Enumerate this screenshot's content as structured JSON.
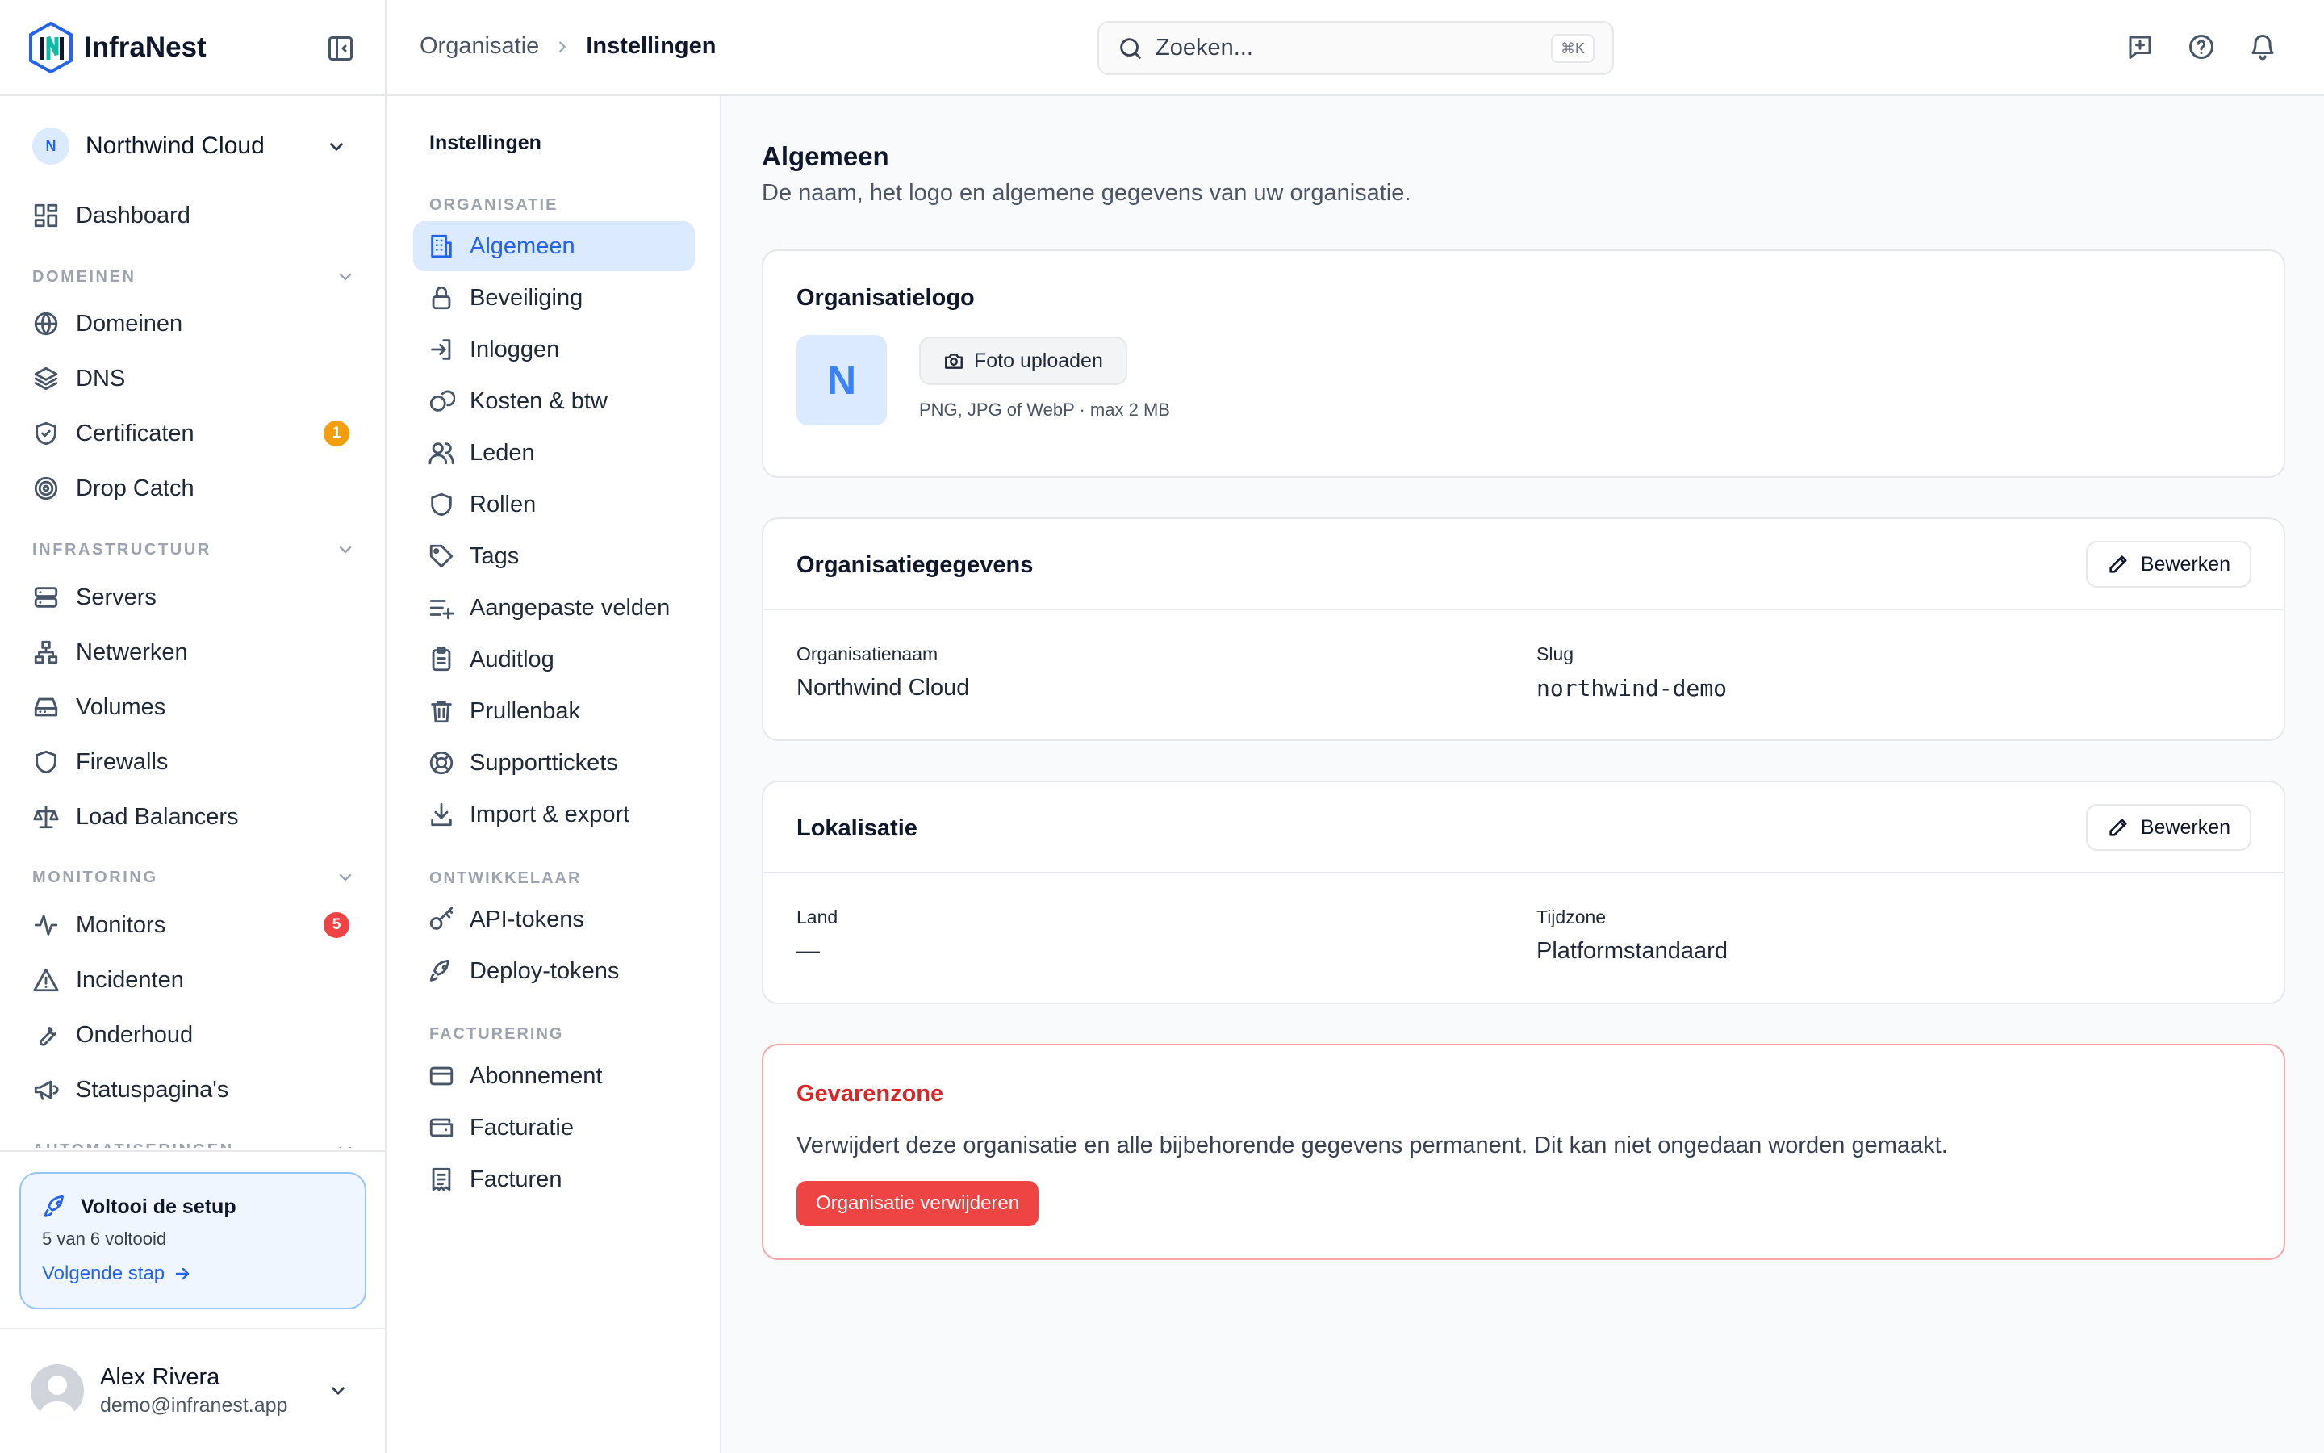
{
  "app": {
    "name": "InfraNest"
  },
  "org_switcher": {
    "initial": "N",
    "name": "Northwind Cloud"
  },
  "sidebar": {
    "dashboard": "Dashboard",
    "sections": {
      "domains": "DOMEINEN",
      "infrastructure": "INFRASTRUCTUUR",
      "monitoring": "MONITORING",
      "automation": "AUTOMATISERINGEN"
    },
    "items": {
      "domains": "Domeinen",
      "dns": "DNS",
      "certificates": "Certificaten",
      "drop_catch": "Drop Catch",
      "servers": "Servers",
      "networks": "Netwerken",
      "volumes": "Volumes",
      "firewalls": "Firewalls",
      "load_balancers": "Load Balancers",
      "monitors": "Monitors",
      "incidents": "Incidenten",
      "maintenance": "Onderhoud",
      "status_pages": "Statuspagina's"
    },
    "badges": {
      "certificates": "1",
      "monitors": "5"
    },
    "badge_colors": {
      "warning": "#f59e0b",
      "danger": "#ef4444"
    }
  },
  "setup": {
    "title": "Voltooi de setup",
    "progress": "5 van 6 voltooid",
    "next": "Volgende stap"
  },
  "user": {
    "name": "Alex Rivera",
    "email": "demo@infranest.app"
  },
  "topbar": {
    "breadcrumb": [
      "Organisatie",
      "Instellingen"
    ],
    "search_placeholder": "Zoeken...",
    "search_shortcut": "⌘K"
  },
  "settings_nav": {
    "title": "Instellingen",
    "sections": {
      "organisation": "ORGANISATIE",
      "developer": "ONTWIKKELAAR",
      "billing": "FACTURERING"
    },
    "items": {
      "general": "Algemeen",
      "security": "Beveiliging",
      "login": "Inloggen",
      "costs": "Kosten & btw",
      "members": "Leden",
      "roles": "Rollen",
      "tags": "Tags",
      "custom_fields": "Aangepaste velden",
      "audit": "Auditlog",
      "trash": "Prullenbak",
      "tickets": "Supporttickets",
      "import_export": "Import & export",
      "api_tokens": "API-tokens",
      "deploy_tokens": "Deploy-tokens",
      "subscription": "Abonnement",
      "invoicing": "Facturatie",
      "invoices": "Facturen"
    },
    "active": "general"
  },
  "main": {
    "title": "Algemeen",
    "description": "De naam, het logo en algemene gegevens van uw organisatie.",
    "logo_card": {
      "title": "Organisatielogo",
      "initial": "N",
      "upload_label": "Foto uploaden",
      "hint": "PNG, JPG of WebP · max 2 MB"
    },
    "org_card": {
      "title": "Organisatiegegevens",
      "edit_label": "Bewerken",
      "name_label": "Organisatienaam",
      "name_value": "Northwind Cloud",
      "slug_label": "Slug",
      "slug_value": "northwind-demo"
    },
    "locale_card": {
      "title": "Lokalisatie",
      "edit_label": "Bewerken",
      "country_label": "Land",
      "country_value": "—",
      "timezone_label": "Tijdzone",
      "timezone_value": "Platformstandaard"
    },
    "danger": {
      "title": "Gevarenzone",
      "text": "Verwijdert deze organisatie en alle bijbehorende gegevens permanent. Dit kan niet ongedaan worden gemaakt.",
      "button": "Organisatie verwijderen"
    }
  },
  "colors": {
    "accent": "#2563eb",
    "danger": "#ef4444",
    "active_bg": "#dbeafe"
  }
}
